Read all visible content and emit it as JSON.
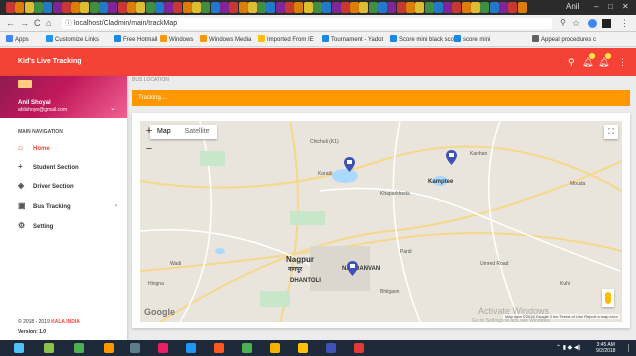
{
  "browser": {
    "window_user": "Anil",
    "url": "localhost/Cladmin/main/trackMap",
    "bookmarks": [
      {
        "label": "Apps",
        "color": "#4285f4"
      },
      {
        "label": "Customize Links",
        "color": "#2196f3"
      },
      {
        "label": "Free Hotmail",
        "color": "#1e88e5"
      },
      {
        "label": "Windows",
        "color": "#ff9800"
      },
      {
        "label": "Windows Media",
        "color": "#ff9800"
      },
      {
        "label": "Imported From IE",
        "color": "#ffc107"
      },
      {
        "label": "Tournament - Yadot",
        "color": "#1e88e5"
      },
      {
        "label": "Score mini black sco",
        "color": "#1e88e5"
      },
      {
        "label": "score mini",
        "color": "#1e88e5"
      },
      {
        "label": "Appeal procedures c",
        "color": "#616161"
      }
    ]
  },
  "app": {
    "title": "Kid's Live Tracking",
    "accent": "#f44336",
    "header_icons": [
      "search-icon",
      "bell-icon",
      "bell-icon",
      "more-vert-icon"
    ]
  },
  "sidebar": {
    "profile": {
      "name": "Anil Shoyal",
      "email": "ahilshoye@gmail.com"
    },
    "nav_header": "MAIN NAVIGATION",
    "items": [
      {
        "label": "Home",
        "icon": "home-icon",
        "active": true
      },
      {
        "label": "Student Section",
        "icon": "plus-icon"
      },
      {
        "label": "Driver Section",
        "icon": "layers-icon"
      },
      {
        "label": "Bus Tracking",
        "icon": "bus-icon",
        "has_children": true
      },
      {
        "label": "Setting",
        "icon": "settings-icon"
      }
    ],
    "footer_copyright": "© 2018 - 2019",
    "footer_brand": "KALA INDIA",
    "footer_version": "Version: 1.0"
  },
  "main": {
    "breadcrumb": "BUS LOCATION",
    "alert": "Tracking....",
    "alert_color": "#ff9800",
    "map": {
      "type_map": "Map",
      "type_satellite": "Satellite",
      "zoom_in": "+",
      "zoom_out": "−",
      "google": "Google",
      "footer": "Map data ©2018 Google  2 km  Terms of Use  Report a map error",
      "labels": [
        {
          "text": "Chicholi (K1)"
        },
        {
          "text": "Kamptee"
        },
        {
          "text": "Koradi"
        },
        {
          "text": "Khaparkheda"
        },
        {
          "text": "Nagpur",
          "kind": "city"
        },
        {
          "text": "नागपूर",
          "kind": "city"
        },
        {
          "text": "NANDANVAN",
          "kind": "town"
        },
        {
          "text": "DHANTOLI",
          "kind": "town"
        },
        {
          "text": "Wadi"
        },
        {
          "text": "Hingna"
        },
        {
          "text": "Bhilgaon"
        },
        {
          "text": "Kanhan"
        },
        {
          "text": "Mouda"
        },
        {
          "text": "Kuhi"
        },
        {
          "text": "Pardi"
        },
        {
          "text": "Umred Road"
        }
      ],
      "markers": [
        {
          "name": "bus-1",
          "color": "#3f51b5"
        },
        {
          "name": "bus-2",
          "color": "#3f51b5"
        },
        {
          "name": "bus-3",
          "color": "#3f51b5"
        }
      ]
    }
  },
  "os": {
    "watermark_title": "Activate Windows",
    "watermark_sub": "Go to Settings to activate Windows.",
    "time": "3:45 AM",
    "date": "9/2/2018"
  }
}
